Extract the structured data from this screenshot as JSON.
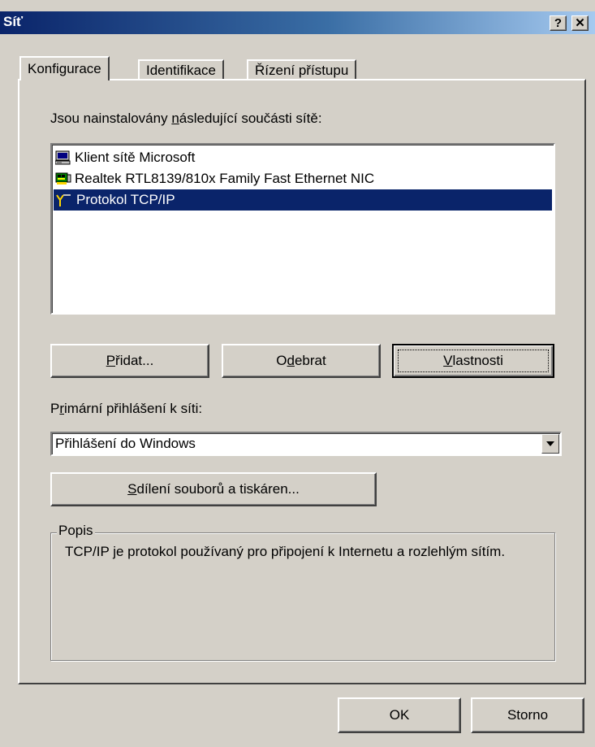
{
  "window": {
    "title": "Síť",
    "help_label": "?",
    "close_label": "✕"
  },
  "tabs": [
    {
      "label": "Konfigurace",
      "active": true
    },
    {
      "label": "Identifikace",
      "active": false
    },
    {
      "label": "Řízení přístupu",
      "active": false
    }
  ],
  "components": {
    "heading_pre": "Jsou nainstalovány ",
    "heading_key": "n",
    "heading_post": "ásledující součásti sítě:",
    "items": [
      {
        "label": "Klient sítě Microsoft",
        "icon": "computer-icon",
        "selected": false
      },
      {
        "label": "Realtek RTL8139/810x Family Fast Ethernet NIC",
        "icon": "network-card-icon",
        "selected": false
      },
      {
        "label": "Protokol TCP/IP",
        "icon": "protocol-icon",
        "selected": true
      }
    ]
  },
  "buttons": {
    "add_key": "P",
    "add_rest": "řidat...",
    "remove_pre": "O",
    "remove_key": "d",
    "remove_post": "ebrat",
    "properties_key": "V",
    "properties_rest": "lastnosti",
    "sharing_key": "S",
    "sharing_rest": "dílení souborů a tiskáren...",
    "ok": "OK",
    "cancel": "Storno"
  },
  "logon": {
    "label_pre": "P",
    "label_key": "r",
    "label_post": "imární přihlášení k síti:",
    "value": "Přihlášení do Windows"
  },
  "description": {
    "title": "Popis",
    "text": "TCP/IP je protokol používaný pro připojení k Internetu a rozlehlým sítím."
  },
  "colors": {
    "selection": "#0a246a",
    "face": "#d4d0c8",
    "title_start": "#0a246a",
    "title_end": "#a6caf0"
  }
}
